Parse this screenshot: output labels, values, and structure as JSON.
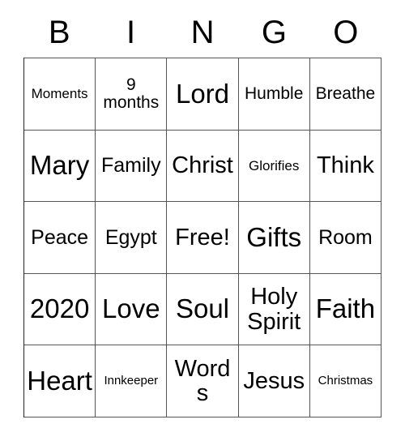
{
  "card": {
    "header_letters": [
      "B",
      "I",
      "N",
      "G",
      "O"
    ],
    "rows": [
      [
        {
          "text": "Moments",
          "size": "sm"
        },
        {
          "text": "9 months",
          "size": "md"
        },
        {
          "text": "Lord",
          "size": "xxl"
        },
        {
          "text": "Humble",
          "size": "md"
        },
        {
          "text": "Breathe",
          "size": "md"
        }
      ],
      [
        {
          "text": "Mary",
          "size": "xxl"
        },
        {
          "text": "Family",
          "size": "lg"
        },
        {
          "text": "Christ",
          "size": "xl"
        },
        {
          "text": "Glorifies",
          "size": "sm"
        },
        {
          "text": "Think",
          "size": "xl"
        }
      ],
      [
        {
          "text": "Peace",
          "size": "lg"
        },
        {
          "text": "Egypt",
          "size": "lg"
        },
        {
          "text": "Free!",
          "size": "xl"
        },
        {
          "text": "Gifts",
          "size": "xxl"
        },
        {
          "text": "Room",
          "size": "lg"
        }
      ],
      [
        {
          "text": "2020",
          "size": "xxl"
        },
        {
          "text": "Love",
          "size": "xxl"
        },
        {
          "text": "Soul",
          "size": "xxl"
        },
        {
          "text": "Holy Spirit",
          "size": "xl"
        },
        {
          "text": "Faith",
          "size": "xxl"
        }
      ],
      [
        {
          "text": "Heart",
          "size": "xxl"
        },
        {
          "text": "Innkeeper",
          "size": "xs"
        },
        {
          "text": "Words",
          "size": "xl"
        },
        {
          "text": "Jesus",
          "size": "xl"
        },
        {
          "text": "Christmas",
          "size": "xs"
        }
      ]
    ]
  },
  "colors": {
    "background": "#ffffff",
    "text": "#000000",
    "grid_line": "#555555"
  }
}
